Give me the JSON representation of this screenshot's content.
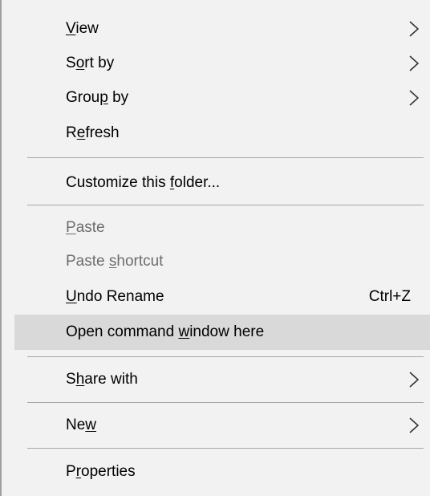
{
  "context_menu": {
    "items": {
      "view": {
        "pre": "",
        "key": "V",
        "post": "iew"
      },
      "sort_by": {
        "pre": "S",
        "key": "o",
        "post": "rt by"
      },
      "group_by": {
        "pre": "Grou",
        "key": "p",
        "post": " by"
      },
      "refresh": {
        "pre": "R",
        "key": "e",
        "post": "fresh"
      },
      "customize": {
        "pre": "Customize this ",
        "key": "f",
        "post": "older..."
      },
      "paste": {
        "pre": "",
        "key": "P",
        "post": "aste"
      },
      "paste_shortcut": {
        "pre": "Paste ",
        "key": "s",
        "post": "hortcut"
      },
      "undo_rename": {
        "pre": "",
        "key": "U",
        "post": "ndo Rename",
        "shortcut": "Ctrl+Z"
      },
      "open_command_window": {
        "pre": "Open command ",
        "key": "w",
        "post": "indow here"
      },
      "share_with": {
        "pre": "S",
        "key": "h",
        "post": "are with"
      },
      "new": {
        "pre": "Ne",
        "key": "w",
        "post": ""
      },
      "properties": {
        "pre": "P",
        "key": "r",
        "post": "operties"
      }
    },
    "icons": {
      "submenu_arrow": "chevron-right-icon"
    },
    "colors": {
      "background": "#f2f2f2",
      "highlight": "#d9d9d9",
      "disabled_text": "#6d6d6d",
      "separator": "#a7a7a7"
    }
  }
}
